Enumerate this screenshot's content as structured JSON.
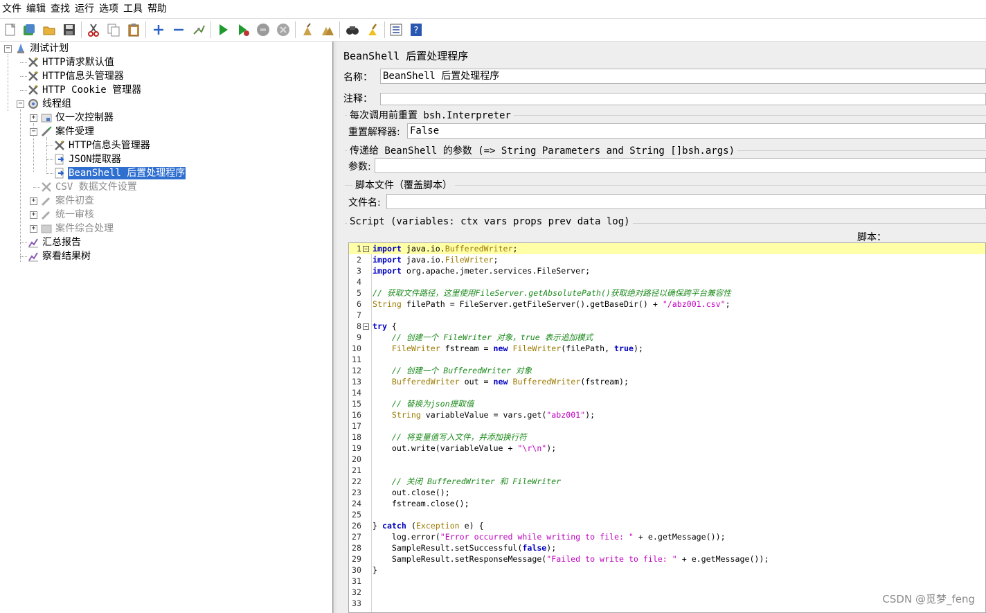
{
  "menu": [
    "文件",
    "编辑",
    "查找",
    "运行",
    "选项",
    "工具",
    "帮助"
  ],
  "toolbar": {
    "icons": [
      "new-icon",
      "templates-icon",
      "open-icon",
      "save-icon",
      "cut-icon",
      "copy-icon",
      "paste-icon",
      "expand-icon",
      "collapse-icon",
      "toggle-icon",
      "start-icon",
      "start-no-pause-icon",
      "stop-icon",
      "shutdown-icon",
      "clear-icon",
      "clear-all-icon",
      "search-icon",
      "reset-search-icon",
      "function-helper-icon",
      "help-icon"
    ]
  },
  "tree": {
    "nodes": [
      {
        "label": "测试计划",
        "icon": "test-plan-icon",
        "state": "normal"
      },
      {
        "label": "HTTP请求默认值",
        "icon": "config-icon",
        "state": "normal"
      },
      {
        "label": "HTTP信息头管理器",
        "icon": "config-icon",
        "state": "normal"
      },
      {
        "label": "HTTP Cookie 管理器",
        "icon": "config-icon",
        "state": "normal"
      },
      {
        "label": "线程组",
        "icon": "thread-group-icon",
        "state": "normal"
      },
      {
        "label": "仅一次控制器",
        "icon": "controller-icon",
        "state": "normal"
      },
      {
        "label": "案件受理",
        "icon": "sampler-icon",
        "state": "normal"
      },
      {
        "label": "HTTP信息头管理器",
        "icon": "config-icon",
        "state": "normal"
      },
      {
        "label": "JSON提取器",
        "icon": "post-processor-icon",
        "state": "normal"
      },
      {
        "label": "BeanShell 后置处理程序",
        "icon": "post-processor-icon",
        "state": "selected"
      },
      {
        "label": "CSV 数据文件设置",
        "icon": "config-icon",
        "state": "disabled"
      },
      {
        "label": "案件初查",
        "icon": "sampler-icon",
        "state": "disabled"
      },
      {
        "label": "统一审核",
        "icon": "sampler-icon",
        "state": "disabled"
      },
      {
        "label": "案件综合处理",
        "icon": "controller-icon",
        "state": "disabled"
      },
      {
        "label": "汇总报告",
        "icon": "listener-icon",
        "state": "normal"
      },
      {
        "label": "察看结果树",
        "icon": "listener-icon",
        "state": "normal"
      }
    ]
  },
  "panel": {
    "title": "BeanShell 后置处理程序",
    "name_label": "名称：",
    "name_value": "BeanShell 后置处理程序",
    "comment_label": "注释：",
    "comment_value": "",
    "reset_group": "每次调用前重置 bsh.Interpreter",
    "reset_label": "重置解释器:",
    "reset_value": "False",
    "params_group": "传递给 BeanShell 的参数 (=> String Parameters and String []bsh.args)",
    "params_label": "参数:",
    "params_value": "",
    "file_group": "脚本文件（覆盖脚本）",
    "file_label": "文件名:",
    "file_value": "",
    "script_group": "Script (variables: ctx vars props prev data log)",
    "script_label": "脚本："
  },
  "script_lines": [
    "import java.io.BufferedWriter;",
    "import java.io.FileWriter;",
    "import org.apache.jmeter.services.FileServer;",
    "",
    "// 获取文件路径，这里使用FileServer.getAbsolutePath()获取绝对路径以确保跨平台兼容性",
    "String filePath = FileServer.getFileServer().getBaseDir() + \"/abz001.csv\";",
    "",
    "try {",
    "    // 创建一个 FileWriter 对象，true 表示追加模式",
    "    FileWriter fstream = new FileWriter(filePath, true);",
    "",
    "    // 创建一个 BufferedWriter 对象",
    "    BufferedWriter out = new BufferedWriter(fstream);",
    "",
    "    // 替换为json提取值",
    "    String variableValue = vars.get(\"abz001\");",
    "",
    "    // 将变量值写入文件，并添加换行符",
    "    out.write(variableValue + \"\\r\\n\");",
    "",
    "",
    "    // 关闭 BufferedWriter 和 FileWriter",
    "    out.close();",
    "    fstream.close();",
    "",
    "} catch (Exception e) {",
    "    log.error(\"Error occurred while writing to file: \" + e.getMessage());",
    "    SampleResult.setSuccessful(false);",
    "    SampleResult.setResponseMessage(\"Failed to write to file: \" + e.getMessage());",
    "}",
    "",
    "",
    ""
  ],
  "watermark": "CSDN @觅梦_feng",
  "colors": {
    "selection": "#2f6fd0",
    "current_line": "#ffffa8",
    "keyword": "#0000c0",
    "type": "#9b7a00",
    "string": "#c000c0",
    "comment": "#1c8a1c"
  }
}
